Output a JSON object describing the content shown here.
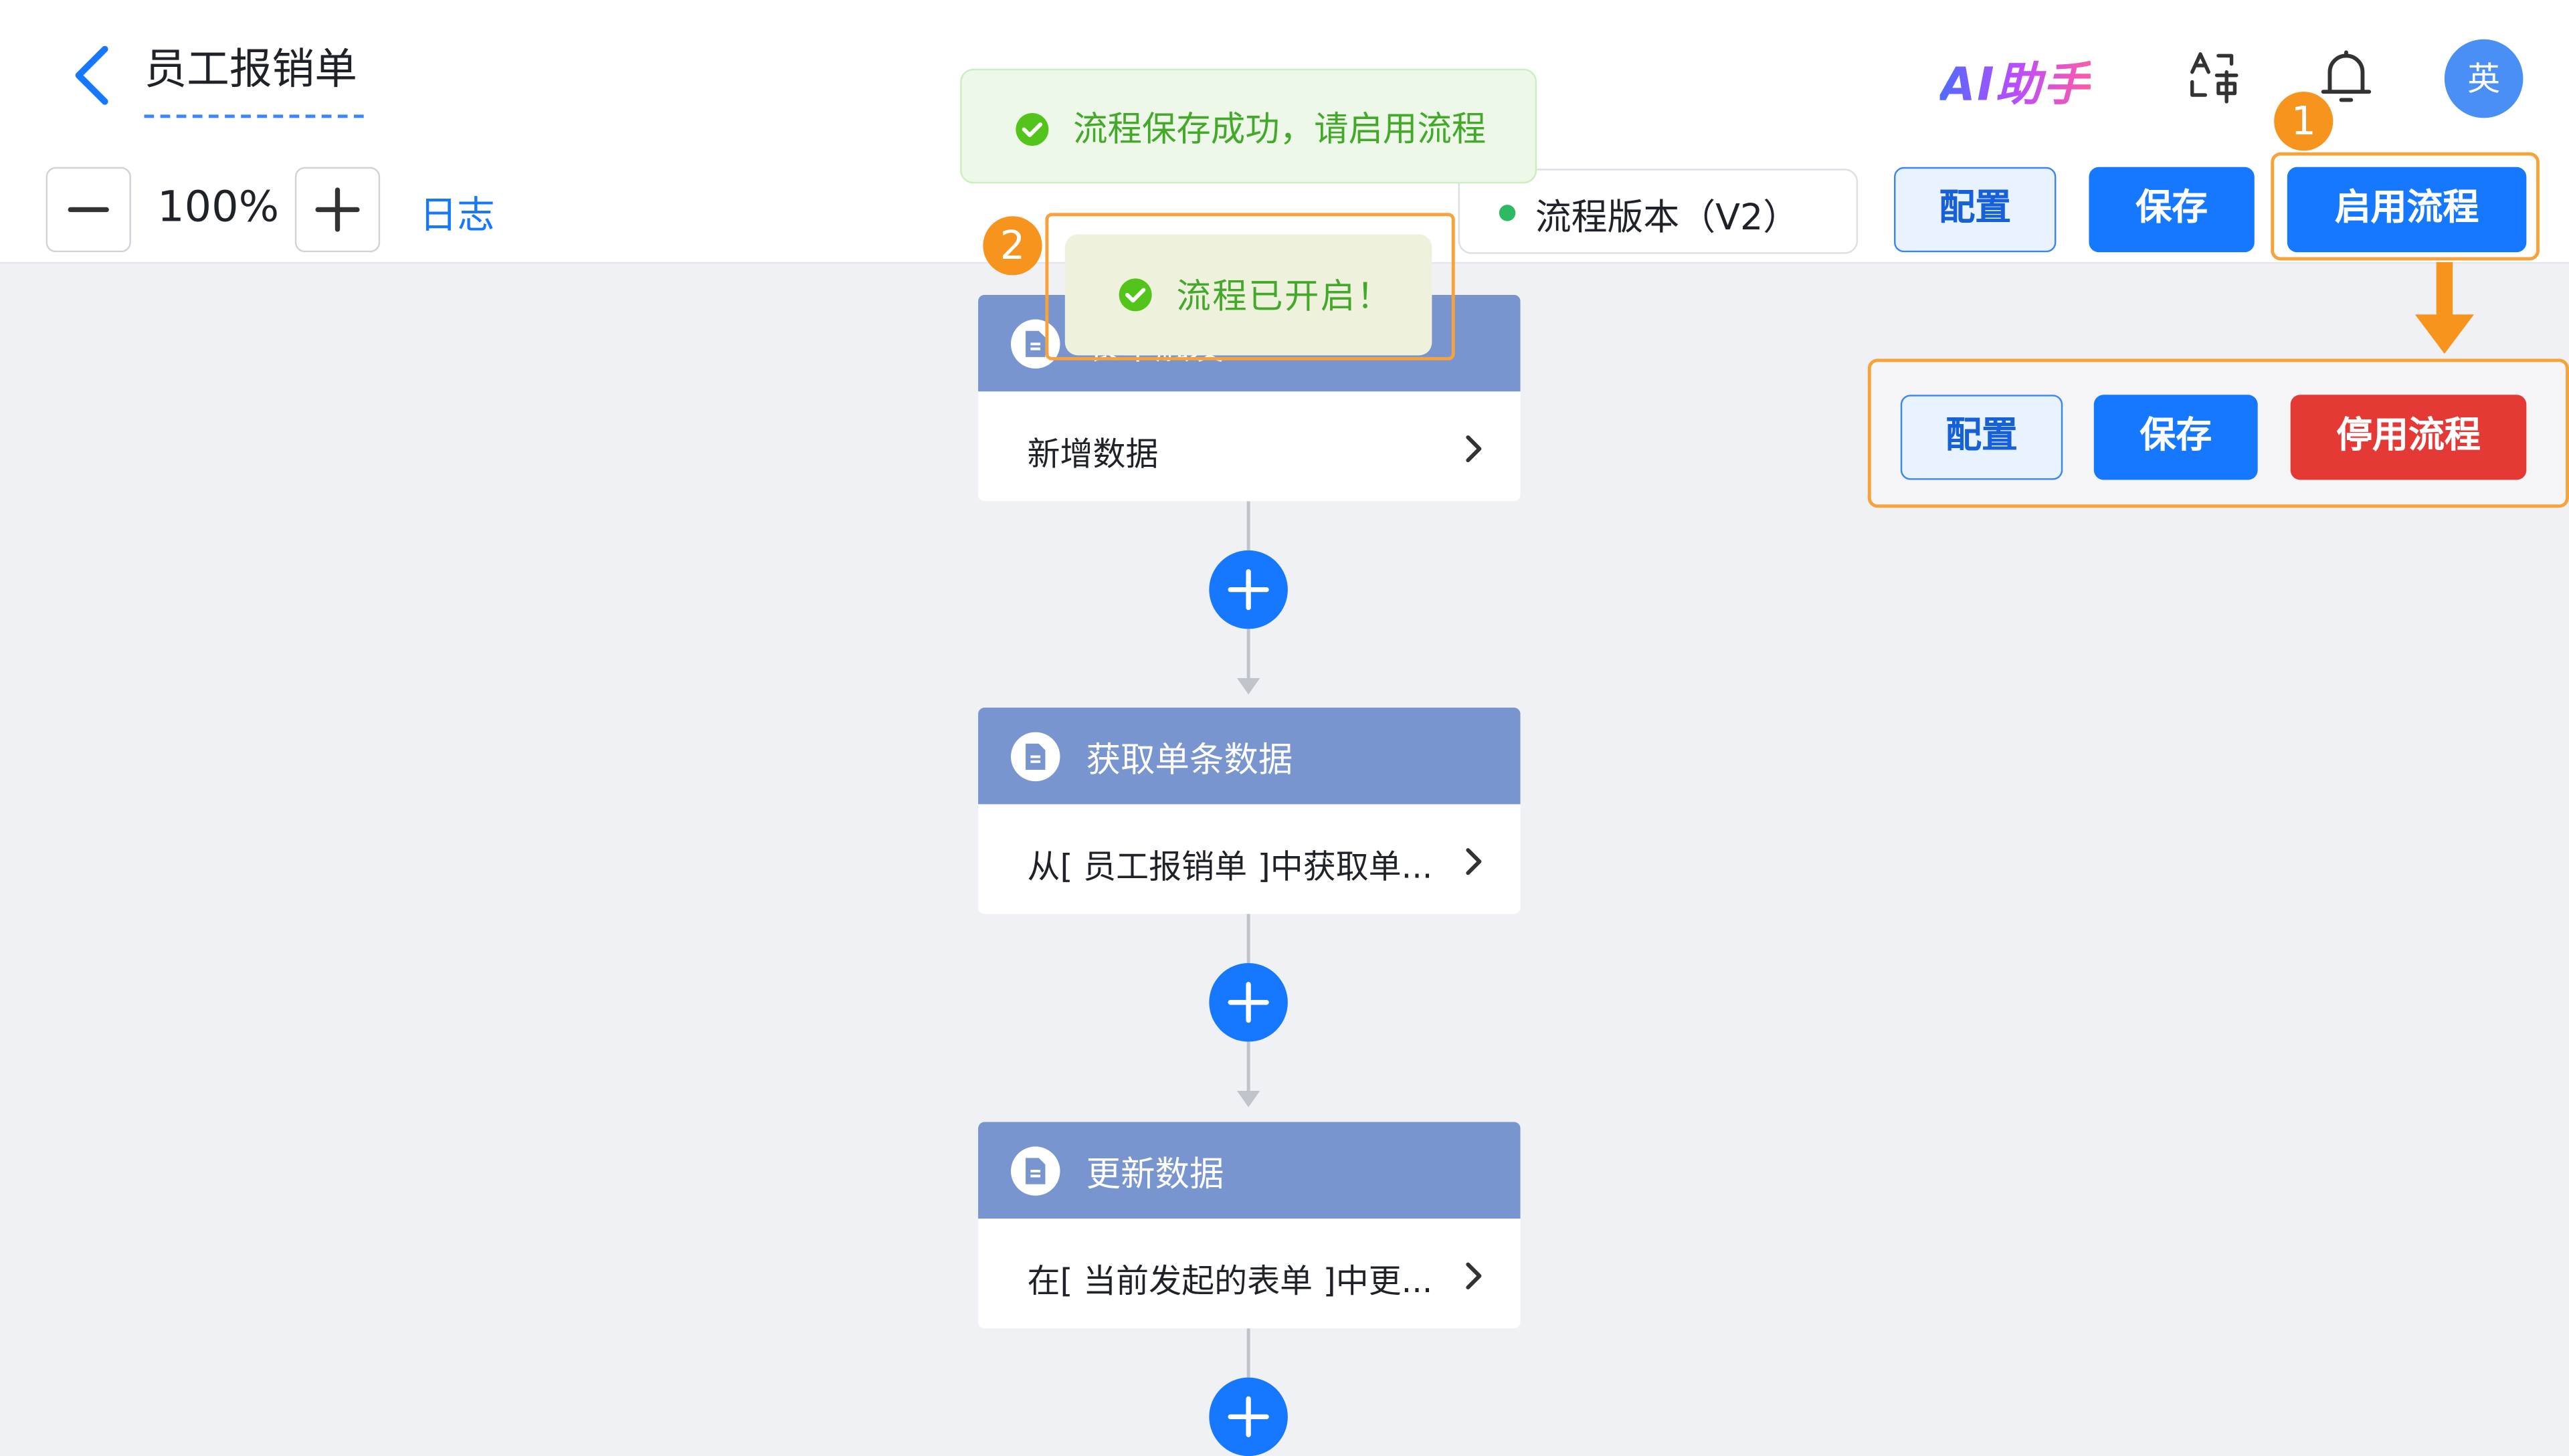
{
  "header": {
    "title": "员工报销单",
    "ai_label": "AI助手",
    "avatar_text": "英"
  },
  "toolbar": {
    "zoom_level": "100%",
    "log_label": "日志",
    "version_label": "流程版本（V2）"
  },
  "actions_before": {
    "config_label": "配置",
    "save_label": "保存",
    "enable_label": "启用流程"
  },
  "actions_after": {
    "config_label": "配置",
    "save_label": "保存",
    "disable_label": "停用流程"
  },
  "annotations": {
    "badge_1": "1",
    "badge_2": "2"
  },
  "toasts": {
    "saved": "流程保存成功，请启用流程",
    "enabled": "流程已开启！"
  },
  "flow": {
    "nodes": [
      {
        "title": "表单触发",
        "desc": "新增数据"
      },
      {
        "title": "获取单条数据",
        "desc": "从[ 员工报销单 ]中获取单..."
      },
      {
        "title": "更新数据",
        "desc": "在[ 当前发起的表单 ]中更..."
      }
    ]
  },
  "colors": {
    "primary": "#1677ff",
    "danger": "#e53935",
    "node_header": "#7895d0",
    "highlight": "#f7a23b",
    "success": "#44a82b"
  }
}
